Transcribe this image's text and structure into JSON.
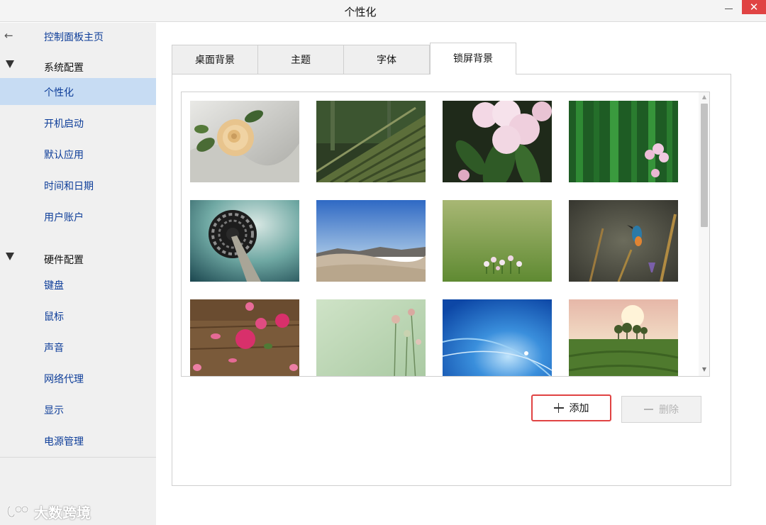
{
  "window": {
    "title": "个性化",
    "minimize_symbol": "",
    "close_symbol": "✕"
  },
  "sidebar": {
    "back_label": "控制面板主页",
    "groups": [
      {
        "label": "系统配置",
        "items": [
          "个性化",
          "开机启动",
          "默认应用",
          "时间和日期",
          "用户账户"
        ]
      },
      {
        "label": "硬件配置",
        "items": [
          "键盘",
          "鼠标",
          "声音",
          "网络代理",
          "显示",
          "电源管理"
        ]
      }
    ],
    "active_item": "个性化"
  },
  "tabs": [
    {
      "label": "桌面背景",
      "active": false
    },
    {
      "label": "主题",
      "active": false
    },
    {
      "label": "字体",
      "active": false
    },
    {
      "label": "锁屏背景",
      "active": true
    }
  ],
  "gallery": {
    "images": [
      {
        "name": "rose-on-fabric-thumbnail"
      },
      {
        "name": "mossy-roof-thumbnail"
      },
      {
        "name": "pink-rhododendron-thumbnail"
      },
      {
        "name": "bamboo-flower-thumbnail"
      },
      {
        "name": "spiral-tower-thumbnail"
      },
      {
        "name": "desert-dunes-thumbnail"
      },
      {
        "name": "grassland-flowers-thumbnail"
      },
      {
        "name": "kingfisher-thumbnail"
      },
      {
        "name": "pink-petals-table-thumbnail"
      },
      {
        "name": "pastel-flowers-thumbnail"
      },
      {
        "name": "blue-abstract-thumbnail"
      },
      {
        "name": "field-trees-sunset-thumbnail"
      }
    ]
  },
  "buttons": {
    "add_label": "添加",
    "delete_label": "删除"
  },
  "watermark": {
    "text": "大数跨境"
  },
  "colors": {
    "accent_blue": "#0d3d99",
    "active_item_bg": "#c7dcf3",
    "close_red": "#e04343",
    "add_button_border": "#e04343"
  }
}
